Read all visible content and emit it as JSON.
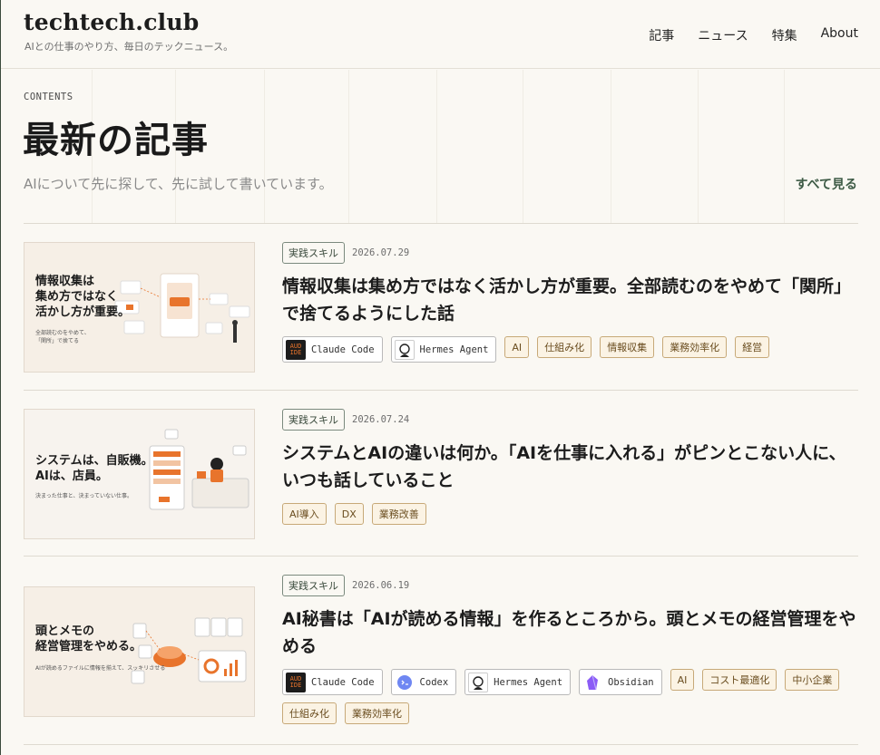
{
  "site": {
    "logo": "techtech.club",
    "tagline": "AIとの仕事のやり方、毎日のテックニュース。"
  },
  "nav": [
    "記事",
    "ニュース",
    "特集",
    "About"
  ],
  "hero": {
    "label": "CONTENTS",
    "title": "最新の記事",
    "subtitle": "AIについて先に探して、先に試して書いています。",
    "see_all": "すべて見る"
  },
  "colors": {
    "background": "#faf8f3",
    "accent_green": "#3d5a45",
    "tag_border": "#c7a978",
    "tag_bg": "#fbf3e4",
    "thumb_orange": "#e8742c"
  },
  "articles": [
    {
      "category": "実践スキル",
      "date": "2026.07.29",
      "title": "情報収集は集め方ではなく活かし方が重要。全部読むのをやめて「関所」で捨てるようにした話",
      "thumb_lines": [
        "情報収集は",
        "集め方ではなく",
        "活かし方が重要。"
      ],
      "thumb_sub": [
        "全部読むのをやめて、",
        "「関所」で捨てる"
      ],
      "tools": [
        {
          "name": "Claude Code",
          "icon": "claude-code-icon"
        },
        {
          "name": "Hermes Agent",
          "icon": "hermes-agent-icon"
        }
      ],
      "tags": [
        "AI",
        "仕組み化",
        "情報収集",
        "業務効率化",
        "経営"
      ]
    },
    {
      "category": "実践スキル",
      "date": "2026.07.24",
      "title": "システムとAIの違いは何か。「AIを仕事に入れる」がピンとこない人に、いつも話していること",
      "thumb_lines": [
        "システムは、自販機。",
        "AIは、店員。"
      ],
      "thumb_sub": [
        "決まった仕事と、決まっていない仕事。"
      ],
      "tools": [],
      "tags": [
        "AI導入",
        "DX",
        "業務改善"
      ]
    },
    {
      "category": "実践スキル",
      "date": "2026.06.19",
      "title": "AI秘書は「AIが読める情報」を作るところから。頭とメモの経営管理をやめる",
      "thumb_lines": [
        "頭とメモの",
        "経営管理をやめる。"
      ],
      "thumb_sub": [
        "AIが読めるファイルに情報を揃えて、スッキリさせる"
      ],
      "tools": [
        {
          "name": "Claude Code",
          "icon": "claude-code-icon"
        },
        {
          "name": "Codex",
          "icon": "codex-icon"
        },
        {
          "name": "Hermes Agent",
          "icon": "hermes-agent-icon"
        },
        {
          "name": "Obsidian",
          "icon": "obsidian-icon"
        }
      ],
      "tags": [
        "AI",
        "コスト最適化",
        "中小企業",
        "仕組み化",
        "業務効率化"
      ]
    }
  ]
}
